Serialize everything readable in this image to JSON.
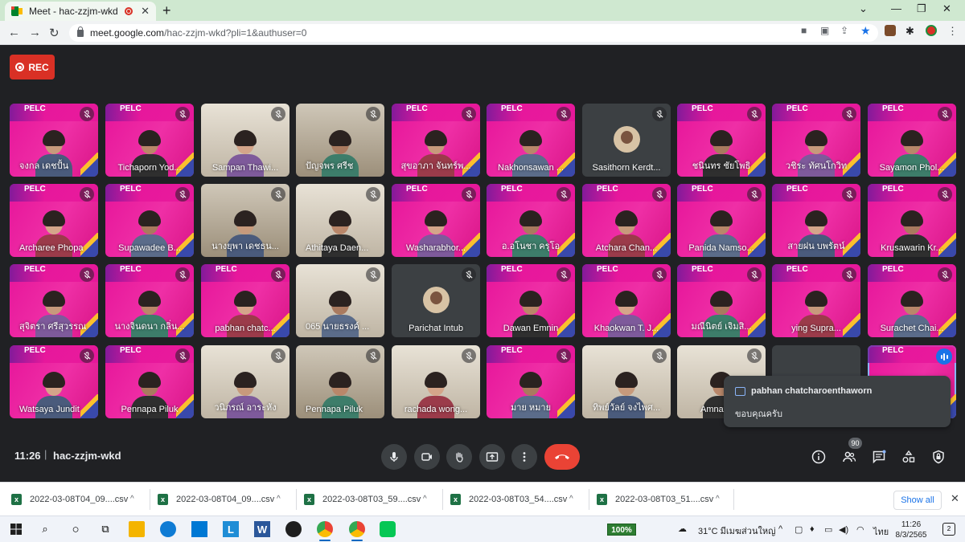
{
  "browser": {
    "tab_title": "Meet - hac-zzjm-wkd",
    "url_host": "meet.google.com",
    "url_path": "/hac-zzjm-wkd?pli=1&authuser=0",
    "close_glyph": "✕",
    "newtab_glyph": "+"
  },
  "meet": {
    "rec_label": "REC",
    "time": "11:26",
    "separator": "|",
    "meeting_code": "hac-zzjm-wkd",
    "participants_count": "90",
    "tiles": [
      {
        "name": "จงกล เดชปั้น",
        "style": "pink"
      },
      {
        "name": "Tichaporn Yod...",
        "style": "pink"
      },
      {
        "name": "Sampan Thawi...",
        "style": "light"
      },
      {
        "name": "ปัญจพร ศรีช",
        "style": "room"
      },
      {
        "name": "สุขอาภา จันทร์พ...",
        "style": "pink"
      },
      {
        "name": "Nakhonsawan ...",
        "style": "pink"
      },
      {
        "name": "Sasithorn Kerdt...",
        "style": "grey"
      },
      {
        "name": "ชนินทร ชัยโพธิ",
        "style": "pink"
      },
      {
        "name": "วชิระ ทัศนโกวิท",
        "style": "pink"
      },
      {
        "name": "Sayamon Phol...",
        "style": "pink"
      },
      {
        "name": "Archaree Phopa",
        "style": "pink"
      },
      {
        "name": "Supawadee B...",
        "style": "pink"
      },
      {
        "name": "นางยุพา เดชธน...",
        "style": "room"
      },
      {
        "name": "Athitaya Daen...",
        "style": "light"
      },
      {
        "name": "Washarabhor...",
        "style": "pink"
      },
      {
        "name": "อ.อโนชา ครุโอ",
        "style": "pink"
      },
      {
        "name": "Atchara Chan...",
        "style": "pink"
      },
      {
        "name": "Panida Namso...",
        "style": "pink"
      },
      {
        "name": "สายฝน บพรัตน์",
        "style": "pink"
      },
      {
        "name": "Krusawarin Kr...",
        "style": "pink"
      },
      {
        "name": "สุจิตรา ศรีสุวรรณ",
        "style": "pink"
      },
      {
        "name": "นางจินดนา กลิ่น...",
        "style": "pink"
      },
      {
        "name": "pabhan chatc...",
        "style": "pink"
      },
      {
        "name": "065 นายธรงค์ ...",
        "style": "light"
      },
      {
        "name": "Parichat Intub",
        "style": "grey"
      },
      {
        "name": "Dawan Emnin",
        "style": "pink"
      },
      {
        "name": "Khaokwan T. J...",
        "style": "pink"
      },
      {
        "name": "มณีนิตย์ เจิมสิ...",
        "style": "pink"
      },
      {
        "name": "ying Supra...",
        "style": "pink"
      },
      {
        "name": "Surachet Chai...",
        "style": "pink"
      },
      {
        "name": "Watsaya Jundit",
        "style": "pink"
      },
      {
        "name": "Pennapa Piluk",
        "style": "pink"
      },
      {
        "name": "วนิภรณ์ อาระหัง",
        "style": "light"
      },
      {
        "name": "Pennapa Piluk",
        "style": "room"
      },
      {
        "name": "rachada wong...",
        "style": "light"
      },
      {
        "name": "มาย หมาย",
        "style": "pink"
      },
      {
        "name": "ทิพย์วัลย์ จงไพศ...",
        "style": "light"
      },
      {
        "name": "Amnat C...",
        "style": "light"
      },
      {
        "name": "",
        "style": "grey"
      },
      {
        "name": "",
        "style": "pink"
      }
    ],
    "toast": {
      "sender": "pabhan chatcharoenthaworn",
      "message": "ขอบคุณครับ"
    }
  },
  "downloads": {
    "items": [
      "2022-03-08T04_09....csv",
      "2022-03-08T04_09....csv",
      "2022-03-08T03_59....csv",
      "2022-03-08T03_54....csv",
      "2022-03-08T03_51....csv"
    ],
    "show_all": "Show all",
    "excel_glyph": "x"
  },
  "taskbar": {
    "battery": "100%",
    "weather": "31°C มีเมฆส่วนใหญ่",
    "lang": "ไทย",
    "time": "11:26",
    "date": "8/3/2565",
    "notif_count": "2"
  },
  "colors": {
    "accent": "#1a73e8",
    "leave": "#ea4335",
    "rec": "#d93025",
    "slide_pink": "#e6149a"
  }
}
